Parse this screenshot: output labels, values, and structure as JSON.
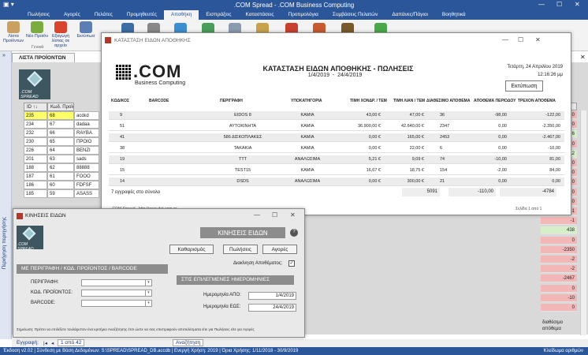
{
  "window": {
    "title": ".COM Spread - .COM Business Computing"
  },
  "menu": [
    "Πωλήσεις",
    "Αγορές",
    "Πελάτες",
    "Προμηθευτές",
    "Αποθήκη",
    "Εισπράξεις",
    "Καταστάσεις",
    "Προτιμολόγια",
    "Συμβάσεις Πελατών",
    "Δαπάνες/Πάγιοι",
    "Βοηθητικά"
  ],
  "ribbon": {
    "btn1": "Λίστα Προϊόντων",
    "btn2": "Νέο Προϊόν",
    "btn3": "Εξαγωγή λίστας σε αρχείο",
    "btn4": "Εκτύπωσ",
    "group": "Γενικά"
  },
  "nav": {
    "label": "Περιήγηση περιηγήσης"
  },
  "products": {
    "tab": "ΛΙΣΤΑ ΠΡΟΪΟΝΤΩΝ",
    "logo": ".COM SPREAD",
    "headers": [
      "ID ↑↓",
      "Κωδ. Προϊόντος"
    ],
    "rows": [
      [
        "235",
        "68",
        "acdεd"
      ],
      [
        "234",
        "67",
        "dadaa"
      ],
      [
        "232",
        "66",
        "RAYBA"
      ],
      [
        "230",
        "65",
        "ΠΡΟΙΟ"
      ],
      [
        "226",
        "64",
        "BENZΙ"
      ],
      [
        "201",
        "63",
        "sads"
      ],
      [
        "188",
        "62",
        "88888"
      ],
      [
        "187",
        "61",
        "FOOO"
      ],
      [
        "186",
        "60",
        "FDFSF"
      ],
      [
        "185",
        "59",
        "ASASS"
      ]
    ],
    "right_header": "Απόθεμα",
    "right_values": [
      "0",
      "0",
      "6",
      "0",
      "12",
      "0",
      "0",
      "0",
      "0",
      "0",
      "-1",
      "-1",
      "438",
      "0",
      "-2350",
      "-2",
      "-2",
      "-2467",
      "0",
      "-10",
      "0"
    ],
    "right_footer": "διαθέσιμο απόθεμα"
  },
  "recnav": {
    "label": "Εγγραφή:",
    "pos": "1 από 42",
    "search": "Αναζήτηση"
  },
  "status": {
    "text": "Έκδοση v2.02  |  Σύνδεση με Βάση Δεδομένων: S:\\SPREAD\\SPREAD_DB.accdb  |  Ενεργή Χρήση: 2019  |  Όρια Χρήσης: 1/11/2018 - 30/9/2019",
    "right": "Κλείδωμα αριθμών"
  },
  "report": {
    "wtitle": "ΚΑΤΑΣΤΑΣΗ ΕΙΔΩΝ ΑΠΟΘΗΚΗΣ",
    "logo_main": ".COM",
    "logo_sub": "Business Computing",
    "heading": "ΚΑΤΑΣΤΑΣΗ ΕΙΔΩΝ ΑΠΟΘΗΚΗΣ - ΠΩΛΗΣΕΙΣ",
    "date_from": "1/4/2019",
    "date_sep": "-",
    "date_to": "24/4/2019",
    "date_today": "Τετάρτη, 24 Απριλίου 2019",
    "time": "12:16:26 μμ",
    "print": "Εκτύπωση",
    "cols": [
      "ΚΩΔΙΚΟΣ",
      "BARCODE",
      "ΠΕΡΙΓΡΑΦΗ",
      "ΥΠΟΚΑΤΗΓΟΡΙΑ",
      "ΤΙΜΗ ΧΟΝΔΡ. / ΤΕΜ",
      "ΤΙΜΗ ΛΙΑΝ / ΤΕΜ",
      "ΔΙΑΘΕΣΙΜΟ ΑΠΟΘΕΜΑ",
      "ΑΠΟΘΕΜΑ ΠΕΡΙΟΔΟΥ",
      "ΤΡΕΧΟΝ ΑΠΟΘΕΜΑ"
    ],
    "rows": [
      [
        "9",
        "",
        "EIDOS 8",
        "ΚΑΜΙΑ",
        "43,00 €",
        "47,00 €",
        "36",
        "-98,00",
        "-122,00"
      ],
      [
        "51",
        "",
        "ΑΥΤΟΚΙΝΗΤΑ",
        "ΚΑΜΙΑ",
        "36.900,00 €",
        "42.640,00 €",
        "2347",
        "0,00",
        "-2.350,00"
      ],
      [
        "41",
        "",
        "586 ΔΙΣΚΟΠΛΑΚΕΣ",
        "ΚΑΜΙΑ",
        "0,00 €",
        "165,00 €",
        "2453",
        "0,00",
        "-2.467,00"
      ],
      [
        "38",
        "",
        "ΤΑΚΑΚΙΑ",
        "ΚΑΜΙΑ",
        "0,00 €",
        "22,00 €",
        "6",
        "0,00",
        "-10,00"
      ],
      [
        "19",
        "",
        "TTT",
        "ΑΝΑΛΩΣΙΜΑ",
        "5,21 €",
        "9,09 €",
        "74",
        "-10,00",
        "81,00"
      ],
      [
        "15",
        "",
        "TEST15",
        "ΚΑΜΙΑ",
        "16,67 €",
        "18,75 €",
        "154",
        "-2,00",
        "84,00"
      ],
      [
        "14",
        "",
        "DSDS",
        "ΑΝΑΛΩΣΙΜΑ",
        "0,00 €",
        "300,00 €",
        "21",
        "0,00",
        "0,00"
      ]
    ],
    "count_label": "7  εγγραφές στο σύνολο",
    "totals": [
      "5091",
      "-110,00",
      "-4784"
    ],
    "footer_left": ".COM Spread - http://www.dot-com.gr",
    "footer_right": "Σελίδα 1 από 1"
  },
  "movements": {
    "wtitle": "ΚΙΝΗΣΕΙΣ ΕΙΔΩΝ",
    "logo": ".COM SPREAD",
    "title": "ΚΙΝΗΣΕΙΣ ΕΙΔΩΝ",
    "help": "?",
    "btn_clear": "Καθαρισμός",
    "btn_sales": "Πωλήσεις",
    "btn_purchases": "Αγορές",
    "del_label": "Διακίνηση Αποθέματος:",
    "del_check": "✓",
    "sec1": "ΜΕ ΠΕΡΙΓΡΑΦΗ / ΚΩΔ. ΠΡΟΪΟΝΤΟΣ / BARCODE",
    "sec2": "ΣΤΙΣ ΕΠΙΛΕΓΜΕΝΕΣ ΗΜΕΡΟΜΗΝΙΕΣ",
    "lbl_desc": "ΠΕΡΙΓΡΑΦΗ:",
    "lbl_code": "ΚΩΔ. ΠΡΟΪΟΝΤΟΣ:",
    "lbl_barcode": "BARCODE:",
    "lbl_from": "Ημερομηνία ΑΠΟ:",
    "lbl_to": "Ημερομηνία ΕΩΣ:",
    "date_from": "1/4/2019",
    "date_to": "24/4/2019",
    "note": "Σημείωση: Πρέπει να επιλέξετε τουλάχιστον ένα κριτήριο Αναζήτησης έτσι ώστε να σας επιστραφούν αποτελέσματα είτε για Πωλήσεις είτε για Αγορές"
  },
  "colors": {
    "accent": "#2b579a",
    "highlight": "#ffff66",
    "negative": "#f4b7b7"
  }
}
